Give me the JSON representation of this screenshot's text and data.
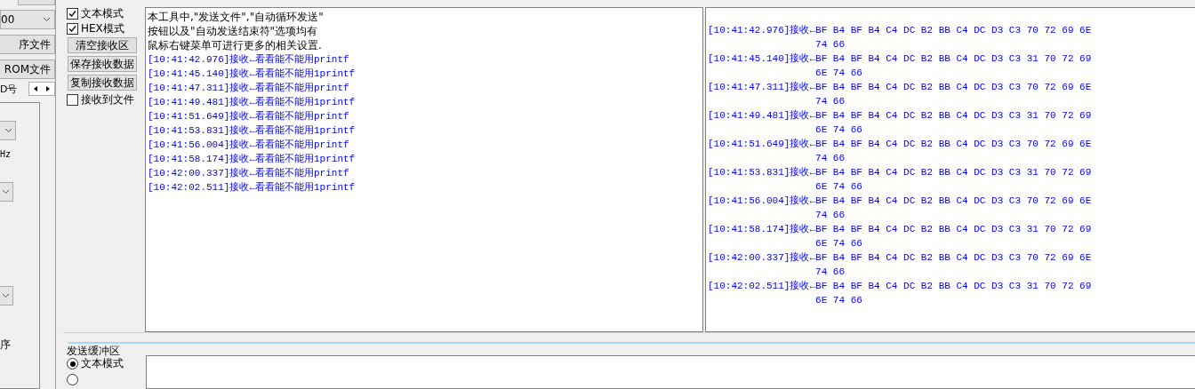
{
  "sidebar": {
    "combo_value": "00",
    "buttons": [
      "序文件",
      "ROM文件"
    ],
    "id_label": "D号",
    "freq_label": "Hz",
    "bottom_label": "序"
  },
  "receive": {
    "options": [
      {
        "label": "文本模式",
        "checked": true
      },
      {
        "label": "HEX模式",
        "checked": true
      }
    ],
    "buttons": [
      "清空接收区",
      "保存接收数据",
      "复制接收数据"
    ],
    "to_file": {
      "label": "接收到文件",
      "checked": false
    },
    "text_pane": {
      "intro": [
        "本工具中,\"发送文件\",\"自动循环发送\"",
        "按钮以及\"自动发送结束符\"选项均有",
        "鼠标右键菜单可进行更多的相关设置."
      ],
      "log": [
        "[10:41:42.976]接收←看看能不能用printf",
        "[10:41:45.140]接收←看看能不能用1printf",
        "[10:41:47.311]接收←看看能不能用printf",
        "[10:41:49.481]接收←看看能不能用1printf",
        "[10:41:51.649]接收←看看能不能用printf",
        "[10:41:53.831]接收←看看能不能用1printf",
        "[10:41:56.004]接收←看看能不能用printf",
        "[10:41:58.174]接收←看看能不能用1printf",
        "[10:42:00.337]接收←看看能不能用printf",
        "[10:42:02.511]接收←看看能不能用1printf"
      ]
    },
    "hex_pane": [
      {
        "prefix": "[10:41:42.976]接收←",
        "line1": "BF B4 BF B4 C4 DC B2 BB C4 DC D3 C3 70 72 69 6E",
        "line2": "74 66"
      },
      {
        "prefix": "[10:41:45.140]接收←",
        "line1": "BF B4 BF B4 C4 DC B2 BB C4 DC D3 C3 31 70 72 69",
        "line2": "6E 74 66"
      },
      {
        "prefix": "[10:41:47.311]接收←",
        "line1": "BF B4 BF B4 C4 DC B2 BB C4 DC D3 C3 70 72 69 6E",
        "line2": "74 66"
      },
      {
        "prefix": "[10:41:49.481]接收←",
        "line1": "BF B4 BF B4 C4 DC B2 BB C4 DC D3 C3 31 70 72 69",
        "line2": "6E 74 66"
      },
      {
        "prefix": "[10:41:51.649]接收←",
        "line1": "BF B4 BF B4 C4 DC B2 BB C4 DC D3 C3 70 72 69 6E",
        "line2": "74 66"
      },
      {
        "prefix": "[10:41:53.831]接收←",
        "line1": "BF B4 BF B4 C4 DC B2 BB C4 DC D3 C3 31 70 72 69",
        "line2": "6E 74 66"
      },
      {
        "prefix": "[10:41:56.004]接收←",
        "line1": "BF B4 BF B4 C4 DC B2 BB C4 DC D3 C3 70 72 69 6E",
        "line2": "74 66"
      },
      {
        "prefix": "[10:41:58.174]接收←",
        "line1": "BF B4 BF B4 C4 DC B2 BB C4 DC D3 C3 31 70 72 69",
        "line2": "6E 74 66"
      },
      {
        "prefix": "[10:42:00.337]接收←",
        "line1": "BF B4 BF B4 C4 DC B2 BB C4 DC D3 C3 70 72 69 6E",
        "line2": "74 66"
      },
      {
        "prefix": "[10:42:02.511]接收←",
        "line1": "BF B4 BF B4 C4 DC B2 BB C4 DC D3 C3 31 70 72 69",
        "line2": "6E 74 66"
      }
    ]
  },
  "send": {
    "title": "发送缓冲区",
    "modes": [
      {
        "label": "文本模式",
        "selected": true
      },
      {
        "selected": false
      }
    ]
  }
}
